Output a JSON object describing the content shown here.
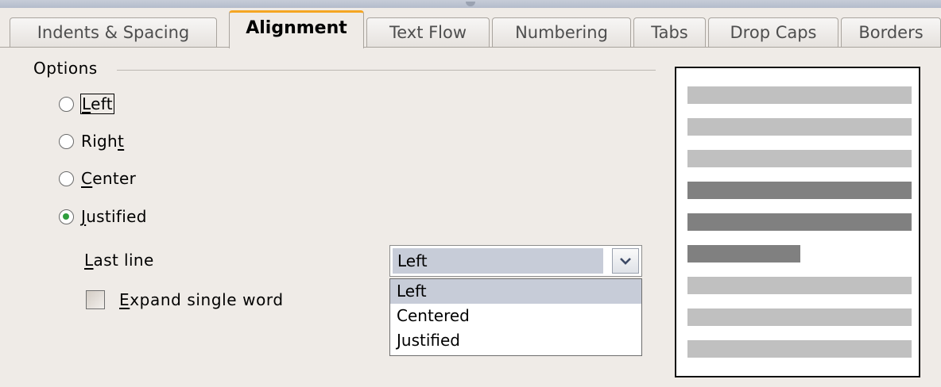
{
  "tabs": [
    {
      "label": "Indents & Spacing",
      "active": false
    },
    {
      "label": "Alignment",
      "active": true
    },
    {
      "label": "Text Flow",
      "active": false
    },
    {
      "label": "Numbering",
      "active": false
    },
    {
      "label": "Tabs",
      "active": false
    },
    {
      "label": "Drop Caps",
      "active": false
    },
    {
      "label": "Borders",
      "active": false
    }
  ],
  "options": {
    "title": "Options",
    "radios": [
      {
        "label": "Left",
        "checked": false
      },
      {
        "label": "Right",
        "checked": false
      },
      {
        "label": "Center",
        "checked": false
      },
      {
        "label": "Justified",
        "checked": true
      }
    ],
    "last_line": {
      "label": "Last line",
      "value": "Left",
      "options": [
        "Left",
        "Centered",
        "Justified"
      ]
    },
    "expand_single_word": {
      "label": "Expand single word",
      "checked": false
    }
  },
  "preview": {
    "line_color_light": "#c0c0c0",
    "line_color_dark": "#808080"
  },
  "colors": {
    "active_tab_accent": "#f5a623",
    "radio_checked": "#2e9e3d",
    "selection": "#c7ccd8"
  }
}
